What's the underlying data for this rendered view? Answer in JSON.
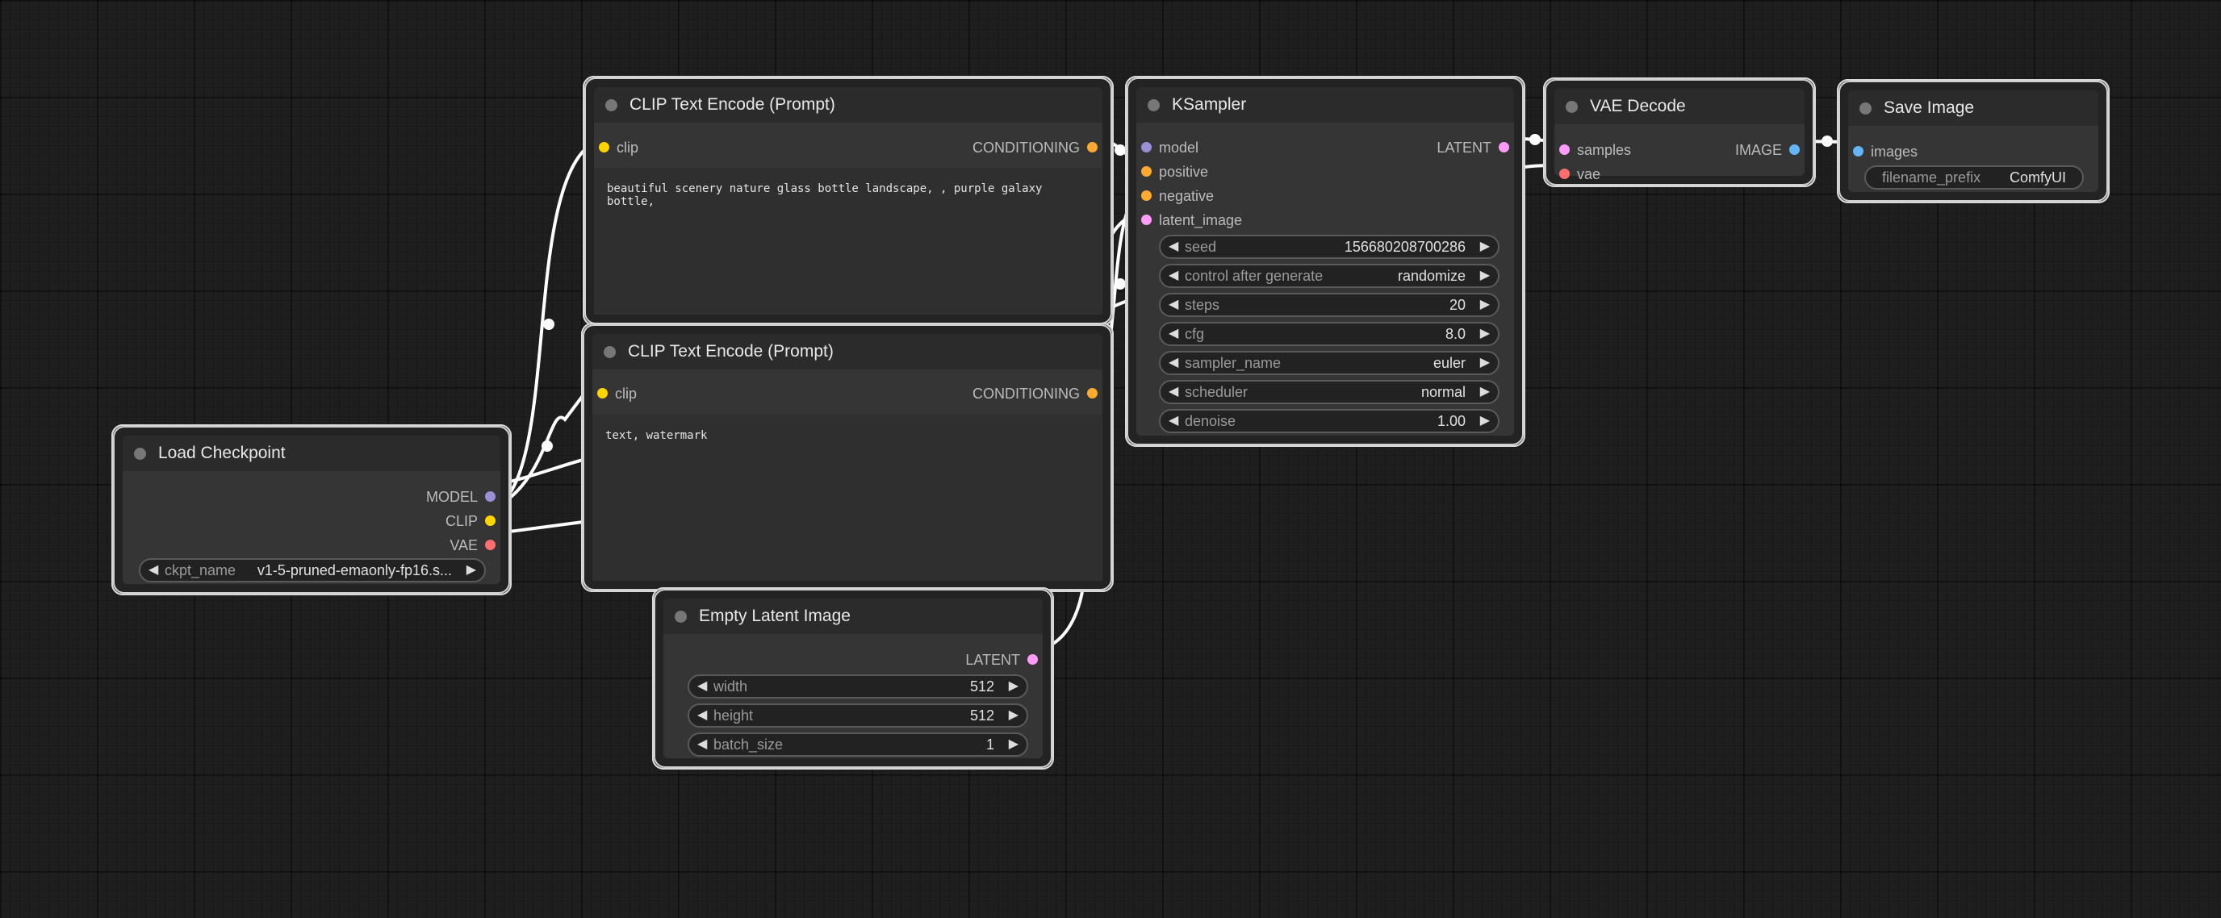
{
  "colors": {
    "model": "#9b8fd6",
    "clip": "#ffd500",
    "vae": "#ff6e6e",
    "conditioning": "#ffa931",
    "latent": "#ff9cf9",
    "image": "#64b5f6",
    "link": "#ffffff"
  },
  "nodes": {
    "clip_pos": {
      "title": "CLIP Text Encode (Prompt)",
      "in_clip": "clip",
      "out_conditioning": "CONDITIONING",
      "text": "beautiful scenery nature glass bottle landscape, , purple galaxy bottle,"
    },
    "clip_neg": {
      "title": "CLIP Text Encode (Prompt)",
      "in_clip": "clip",
      "out_conditioning": "CONDITIONING",
      "text": "text, watermark"
    },
    "ksampler": {
      "title": "KSampler",
      "inputs": [
        "model",
        "positive",
        "negative",
        "latent_image"
      ],
      "out_latent": "LATENT",
      "widgets": [
        {
          "name": "seed",
          "value": "156680208700286"
        },
        {
          "name": "control after generate",
          "value": "randomize"
        },
        {
          "name": "steps",
          "value": "20"
        },
        {
          "name": "cfg",
          "value": "8.0"
        },
        {
          "name": "sampler_name",
          "value": "euler"
        },
        {
          "name": "scheduler",
          "value": "normal"
        },
        {
          "name": "denoise",
          "value": "1.00"
        }
      ]
    },
    "vae_decode": {
      "title": "VAE Decode",
      "in_samples": "samples",
      "in_vae": "vae",
      "out_image": "IMAGE"
    },
    "save_image": {
      "title": "Save Image",
      "in_images": "images",
      "widget_name": "filename_prefix",
      "widget_value": "ComfyUI"
    },
    "load_checkpoint": {
      "title": "Load Checkpoint",
      "out_model": "MODEL",
      "out_clip": "CLIP",
      "out_vae": "VAE",
      "widget_name": "ckpt_name",
      "widget_value": "v1-5-pruned-emaonly-fp16.s..."
    },
    "empty_latent": {
      "title": "Empty Latent Image",
      "out_latent": "LATENT",
      "widgets": [
        {
          "name": "width",
          "value": "512"
        },
        {
          "name": "height",
          "value": "512"
        },
        {
          "name": "batch_size",
          "value": "1"
        }
      ]
    }
  }
}
